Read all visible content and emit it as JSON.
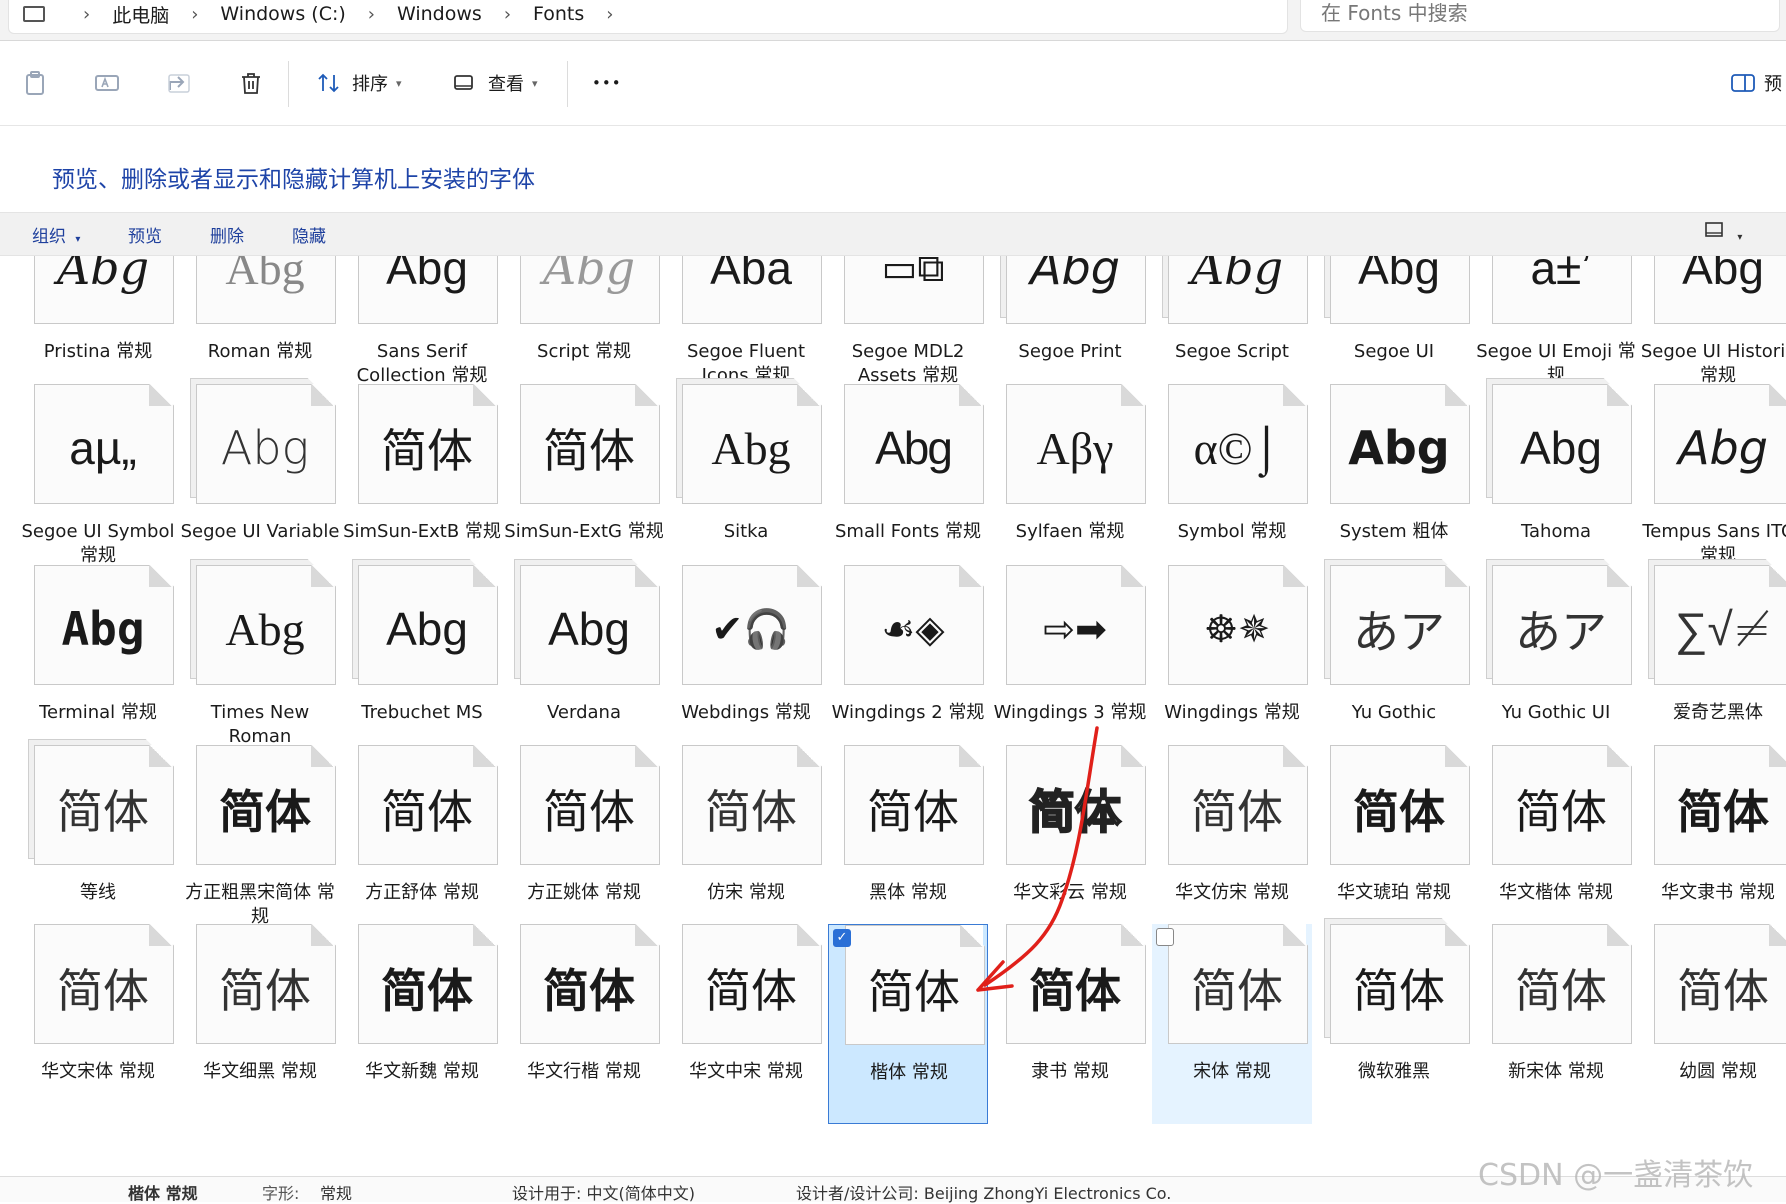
{
  "address": {
    "crumbs": [
      "此电脑",
      "Windows (C:)",
      "Windows",
      "Fonts"
    ],
    "search_placeholder": "在 Fonts 中搜索"
  },
  "toolbar": {
    "sort_label": "排序",
    "view_label": "查看",
    "more_label": "•••",
    "preview_pane_label": "预"
  },
  "description": "预览、删除或者显示和隐藏计算机上安装的字体",
  "commands": {
    "organize": "组织",
    "preview": "预览",
    "delete": "删除",
    "hide": "隐藏"
  },
  "rows": [
    {
      "offset": -52,
      "tiles": [
        {
          "name": "Pristina 常规",
          "sample": "Abg",
          "style": "script1",
          "stack": false
        },
        {
          "name": "Roman 常规",
          "sample": "Abg",
          "style": "roman",
          "stack": false
        },
        {
          "name": "Sans Serif Collection 常规",
          "sample": "Abg",
          "style": "sans",
          "stack": false
        },
        {
          "name": "Script 常规",
          "sample": "Abg",
          "style": "script2",
          "stack": false
        },
        {
          "name": "Segoe Fluent Icons 常规",
          "sample": "Aba",
          "style": "sans",
          "stack": false
        },
        {
          "name": "Segoe MDL2 Assets 常规",
          "sample": "▭⧉",
          "style": "icons",
          "stack": false
        },
        {
          "name": "Segoe Print",
          "sample": "Abg",
          "style": "print",
          "stack": true
        },
        {
          "name": "Segoe Script",
          "sample": "Abg",
          "style": "script1",
          "stack": true
        },
        {
          "name": "Segoe UI",
          "sample": "Abg",
          "style": "sans",
          "stack": true
        },
        {
          "name": "Segoe UI Emoji 常规",
          "sample": "a±ʼ",
          "style": "sans",
          "stack": false
        },
        {
          "name": "Segoe UI Historic 常规",
          "sample": "Abg",
          "style": "sans",
          "stack": false
        }
      ]
    },
    {
      "offset": 128,
      "tiles": [
        {
          "name": "Segoe UI Symbol 常规",
          "sample": "aµ„",
          "style": "sans",
          "stack": false
        },
        {
          "name": "Segoe UI Variable",
          "sample": "Abg",
          "style": "sansLight",
          "stack": true
        },
        {
          "name": "SimSun-ExtB 常规",
          "sample": "简体",
          "style": "song",
          "stack": false
        },
        {
          "name": "SimSun-ExtG 常规",
          "sample": "简体",
          "style": "song",
          "stack": false
        },
        {
          "name": "Sitka",
          "sample": "Abg",
          "style": "serif",
          "stack": true
        },
        {
          "name": "Small Fonts 常规",
          "sample": "Abg",
          "style": "condensed",
          "stack": false
        },
        {
          "name": "Sylfaen 常规",
          "sample": "Αβγ",
          "style": "serif",
          "stack": false
        },
        {
          "name": "Symbol 常规",
          "sample": "α©⌡",
          "style": "serif",
          "stack": false
        },
        {
          "name": "System 粗体",
          "sample": "Abg",
          "style": "bold",
          "stack": false
        },
        {
          "name": "Tahoma",
          "sample": "Abg",
          "style": "sans",
          "stack": true
        },
        {
          "name": "Tempus Sans ITC 常规",
          "sample": "Abg",
          "style": "print",
          "stack": false
        }
      ]
    },
    {
      "offset": 309,
      "tiles": [
        {
          "name": "Terminal 常规",
          "sample": "Abg",
          "style": "mono",
          "stack": false
        },
        {
          "name": "Times New Roman",
          "sample": "Abg",
          "style": "serif",
          "stack": true
        },
        {
          "name": "Trebuchet MS",
          "sample": "Abg",
          "style": "sans",
          "stack": true
        },
        {
          "name": "Verdana",
          "sample": "Abg",
          "style": "sans",
          "stack": true
        },
        {
          "name": "Webdings 常规",
          "sample": "✔🎧",
          "style": "icons",
          "stack": false
        },
        {
          "name": "Wingdings 2 常规",
          "sample": "☙◈",
          "style": "icons",
          "stack": false
        },
        {
          "name": "Wingdings 3 常规",
          "sample": "⇨➡",
          "style": "icons",
          "stack": false
        },
        {
          "name": "Wingdings 常规",
          "sample": "☸✵",
          "style": "icons",
          "stack": false
        },
        {
          "name": "Yu Gothic",
          "sample": "あア",
          "style": "sansLight",
          "stack": true
        },
        {
          "name": "Yu Gothic UI",
          "sample": "あア",
          "style": "sansLight",
          "stack": true
        },
        {
          "name": "爱奇艺黑体",
          "sample": "∑√≠",
          "style": "sansLight",
          "stack": true
        }
      ]
    },
    {
      "offset": 489,
      "tiles": [
        {
          "name": "等线",
          "sample": "简体",
          "style": "sansLight",
          "stack": true
        },
        {
          "name": "方正粗黑宋简体 常规",
          "sample": "简体",
          "style": "bold",
          "stack": false
        },
        {
          "name": "方正舒体 常规",
          "sample": "简体",
          "style": "song",
          "stack": false
        },
        {
          "name": "方正姚体 常规",
          "sample": "简体",
          "style": "song",
          "stack": false
        },
        {
          "name": "仿宋 常规",
          "sample": "简体",
          "style": "sansLight",
          "stack": false
        },
        {
          "name": "黑体 常规",
          "sample": "简体",
          "style": "sans",
          "stack": false
        },
        {
          "name": "华文彩云 常规",
          "sample": "简体",
          "style": "outline",
          "stack": false
        },
        {
          "name": "华文仿宋 常规",
          "sample": "简体",
          "style": "sansLight",
          "stack": false
        },
        {
          "name": "华文琥珀 常规",
          "sample": "简体",
          "style": "bold",
          "stack": false
        },
        {
          "name": "华文楷体 常规",
          "sample": "简体",
          "style": "song",
          "stack": false
        },
        {
          "name": "华文隶书 常规",
          "sample": "简体",
          "style": "bold",
          "stack": false
        }
      ]
    },
    {
      "offset": 668,
      "tiles": [
        {
          "name": "华文宋体 常规",
          "sample": "简体",
          "style": "sansLight",
          "stack": false
        },
        {
          "name": "华文细黑 常规",
          "sample": "简体",
          "style": "sansLight",
          "stack": false
        },
        {
          "name": "华文新魏 常规",
          "sample": "简体",
          "style": "bold",
          "stack": false
        },
        {
          "name": "华文行楷 常规",
          "sample": "简体",
          "style": "bold",
          "stack": false
        },
        {
          "name": "华文中宋 常规",
          "sample": "简体",
          "style": "sans",
          "stack": false
        },
        {
          "name": "楷体 常规",
          "sample": "简体",
          "style": "song",
          "stack": false,
          "state": "selected"
        },
        {
          "name": "隶书 常规",
          "sample": "简体",
          "style": "bold",
          "stack": false
        },
        {
          "name": "宋体 常规",
          "sample": "简体",
          "style": "sansLight",
          "stack": false,
          "state": "hover"
        },
        {
          "name": "微软雅黑",
          "sample": "简体",
          "style": "sans",
          "stack": true
        },
        {
          "name": "新宋体 常规",
          "sample": "简体",
          "style": "sansLight",
          "stack": false
        },
        {
          "name": "幼圆 常规",
          "sample": "简体",
          "style": "sansLight",
          "stack": false
        }
      ]
    }
  ],
  "status": {
    "name": "楷体 常规",
    "style_label": "字形:",
    "style_value": "常规",
    "designed_for": "设计用于: 中文(简体中文)",
    "designer": "设计者/设计公司: Beijing ZhongYi Electronics Co."
  },
  "watermark": "CSDN @一盏清茶饮",
  "colors": {
    "accent": "#1e44a8",
    "selected": "#cce8ff",
    "arrow": "#e0201a"
  }
}
